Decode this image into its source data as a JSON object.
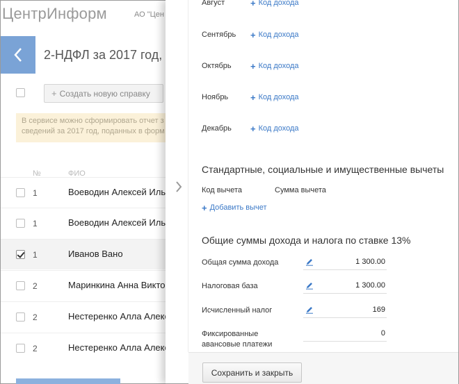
{
  "app": {
    "brand": "ЦентрИнформ",
    "org": "АО \"Цен",
    "page_title": "2-НДФЛ за 2017 год, с",
    "create_button": "Создать новую справку",
    "notice_lines": [
      "В сервисе можно сформировать отчет з",
      "сведений за 2017 год, поданных в форм"
    ],
    "table": {
      "headers": [
        "№",
        "ФИО"
      ],
      "rows": [
        {
          "num": "1",
          "fio": "Воеводин Алексей Иль",
          "checked": false
        },
        {
          "num": "1",
          "fio": "Воеводин Алексей Иль",
          "checked": false
        },
        {
          "num": "1",
          "fio": "Иванов Вано",
          "checked": true
        },
        {
          "num": "2",
          "fio": "Маринкина Анна Викто",
          "checked": false
        },
        {
          "num": "2",
          "fio": "Нестеренко Алла Алекс",
          "checked": false
        },
        {
          "num": "2",
          "fio": "Нестеренко Алла Алекс",
          "checked": false
        }
      ]
    }
  },
  "panel": {
    "months": [
      {
        "label": "Август",
        "action": "Код дохода"
      },
      {
        "label": "Сентябрь",
        "action": "Код дохода"
      },
      {
        "label": "Октябрь",
        "action": "Код дохода"
      },
      {
        "label": "Ноябрь",
        "action": "Код дохода"
      },
      {
        "label": "Декабрь",
        "action": "Код дохода"
      }
    ],
    "deductions": {
      "title": "Стандартные, социальные и имущественные вычеты",
      "col_code": "Код вычета",
      "col_sum": "Сумма вычета",
      "add_label": "Добавить вычет"
    },
    "totals": {
      "title": "Общие суммы дохода и налога по ставке 13%",
      "items": [
        {
          "label": "Общая сумма дохода",
          "value": "1 300.00",
          "editable": true
        },
        {
          "label": "Налоговая база",
          "value": "1 300.00",
          "editable": true
        },
        {
          "label": "Исчисленный налог",
          "value": "169",
          "editable": true
        },
        {
          "label": "Фиксированные авансовые платежи",
          "value": "0",
          "editable": false
        }
      ]
    },
    "save_button": "Сохранить и закрыть"
  },
  "colors": {
    "accent": "#3b79c7",
    "back_button": "#7aa3d6",
    "notice_bg": "#fbf1d9"
  }
}
